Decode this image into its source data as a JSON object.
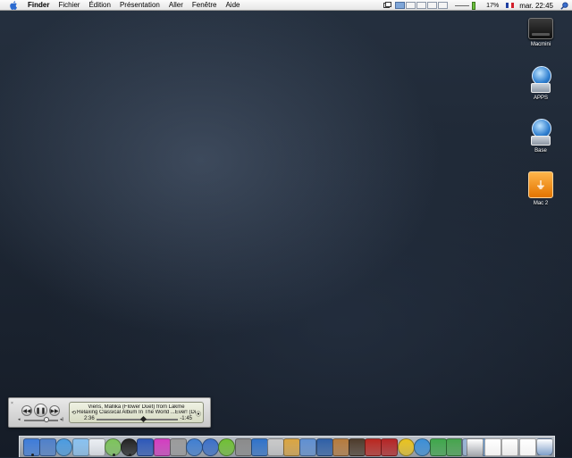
{
  "menubar": {
    "apple_icon": "apple-icon",
    "items": [
      "Finder",
      "Fichier",
      "Édition",
      "Présentation",
      "Aller",
      "Fenêtre",
      "Aide"
    ],
    "battery_percent": "17%",
    "clock": "mar. 22:45",
    "language_flag": "french-flag"
  },
  "desktop_icons": [
    {
      "label": "Macmini",
      "icon": "black-hard-drive-icon"
    },
    {
      "label": "APPS",
      "icon": "network-globe-drive-icon"
    },
    {
      "label": "Base",
      "icon": "network-globe-drive-icon"
    },
    {
      "label": "Mac 2",
      "icon": "orange-external-drive-icon"
    }
  ],
  "player": {
    "track_line": "Viens, Mallika (Flower Duet) from Lakme",
    "album_line": "Relaxing Classical Album In The World ...Ever! (Di",
    "elapsed": "2:36",
    "remaining": "-1:45",
    "progress": 0.58,
    "volume": 0.7
  },
  "dock": {
    "items": [
      {
        "icon": "finder-icon",
        "color": "#3d7bd9"
      },
      {
        "icon": "mail-icon",
        "color": "#4e7fc9"
      },
      {
        "icon": "safari-icon",
        "color": "#4a9be0"
      },
      {
        "icon": "ichat-icon",
        "color": "#88c1f0"
      },
      {
        "icon": "preview-icon",
        "color": "#e9edf2"
      },
      {
        "icon": "itunes-icon",
        "color": "#7cc45a"
      },
      {
        "icon": "dashboard-icon",
        "color": "#222222"
      },
      {
        "icon": "bluetooth-icon",
        "color": "#2d58b8"
      },
      {
        "icon": "colorsync-icon",
        "color": "#d23cc0"
      },
      {
        "icon": "calculator-icon",
        "color": "#9a9a9a"
      },
      {
        "icon": "network-icon",
        "color": "#3f7ed1"
      },
      {
        "icon": "quicktime-icon",
        "color": "#3a6fc8"
      },
      {
        "icon": "green-app-icon",
        "color": "#6fbf33"
      },
      {
        "icon": "help-icon",
        "color": "#8a8a8a"
      },
      {
        "icon": "app-store-icon",
        "color": "#2f72c9"
      },
      {
        "icon": "script-editor-icon",
        "color": "#c8c8c8"
      },
      {
        "icon": "sketch-icon",
        "color": "#d9a441"
      },
      {
        "icon": "photoshop-icon",
        "color": "#5f8fd1"
      },
      {
        "icon": "pencil-icon",
        "color": "#2e5fa6"
      },
      {
        "icon": "teddy-bear-icon",
        "color": "#b57a3c"
      },
      {
        "icon": "cube-icon",
        "color": "#4d3b2b"
      },
      {
        "icon": "red-app-icon",
        "color": "#b9261f"
      },
      {
        "icon": "tools-icon",
        "color": "#b42424"
      },
      {
        "icon": "sunflower-icon",
        "color": "#e8c21e"
      },
      {
        "icon": "globe-icon",
        "color": "#3a8ed6"
      },
      {
        "icon": "dreamweaver-icon",
        "color": "#3ea64a"
      },
      {
        "icon": "leaf-icon",
        "color": "#45a34c"
      },
      {
        "icon": "computer-icon",
        "color": "#98b4d6"
      },
      {
        "icon": "network-people-icon",
        "color": "#5b9be0"
      }
    ],
    "right_items": [
      {
        "icon": "drive-tray-icon",
        "color": "#a6aab0"
      },
      {
        "icon": "document-icon",
        "color": "#f0f0f0"
      },
      {
        "icon": "document-stack-icon",
        "color": "#e8e8e8"
      },
      {
        "icon": "document-list-icon",
        "color": "#f2f2f2"
      },
      {
        "icon": "trash-icon",
        "color": "#7f9fc9"
      }
    ]
  }
}
